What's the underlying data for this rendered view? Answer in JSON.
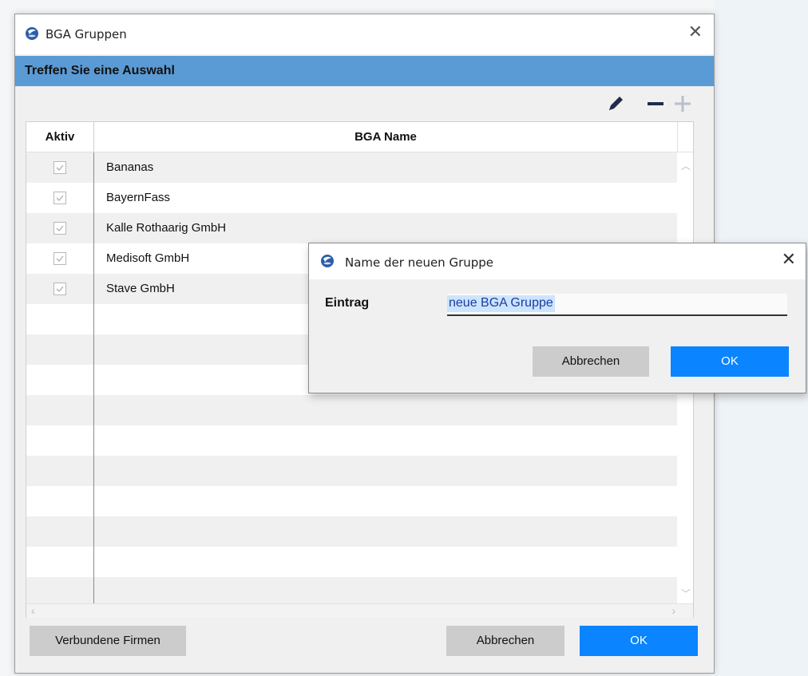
{
  "main_window": {
    "title": "BGA Gruppen",
    "banner": "Treffen Sie eine Auswahl",
    "toolbar": {
      "edit_icon": "pencil-icon",
      "remove_icon": "minus-icon",
      "add_icon": "plus-icon"
    },
    "table": {
      "columns": [
        "Aktiv",
        "BGA Name"
      ],
      "rows": [
        {
          "aktiv": true,
          "name": "Bananas"
        },
        {
          "aktiv": true,
          "name": "BayernFass"
        },
        {
          "aktiv": true,
          "name": "Kalle Rothaarig GmbH"
        },
        {
          "aktiv": true,
          "name": "Medisoft GmbH"
        },
        {
          "aktiv": true,
          "name": "Stave GmbH"
        }
      ]
    },
    "buttons": {
      "linked_companies": "Verbundene Firmen",
      "cancel": "Abbrechen",
      "ok": "OK"
    }
  },
  "dialog": {
    "title": "Name der neuen Gruppe",
    "field_label": "Eintrag",
    "field_value": "neue BGA Gruppe",
    "buttons": {
      "cancel": "Abbrechen",
      "ok": "OK"
    }
  },
  "colors": {
    "banner": "#5b9bd5",
    "primary_button": "#0a84ff",
    "secondary_button": "#cccccc"
  }
}
